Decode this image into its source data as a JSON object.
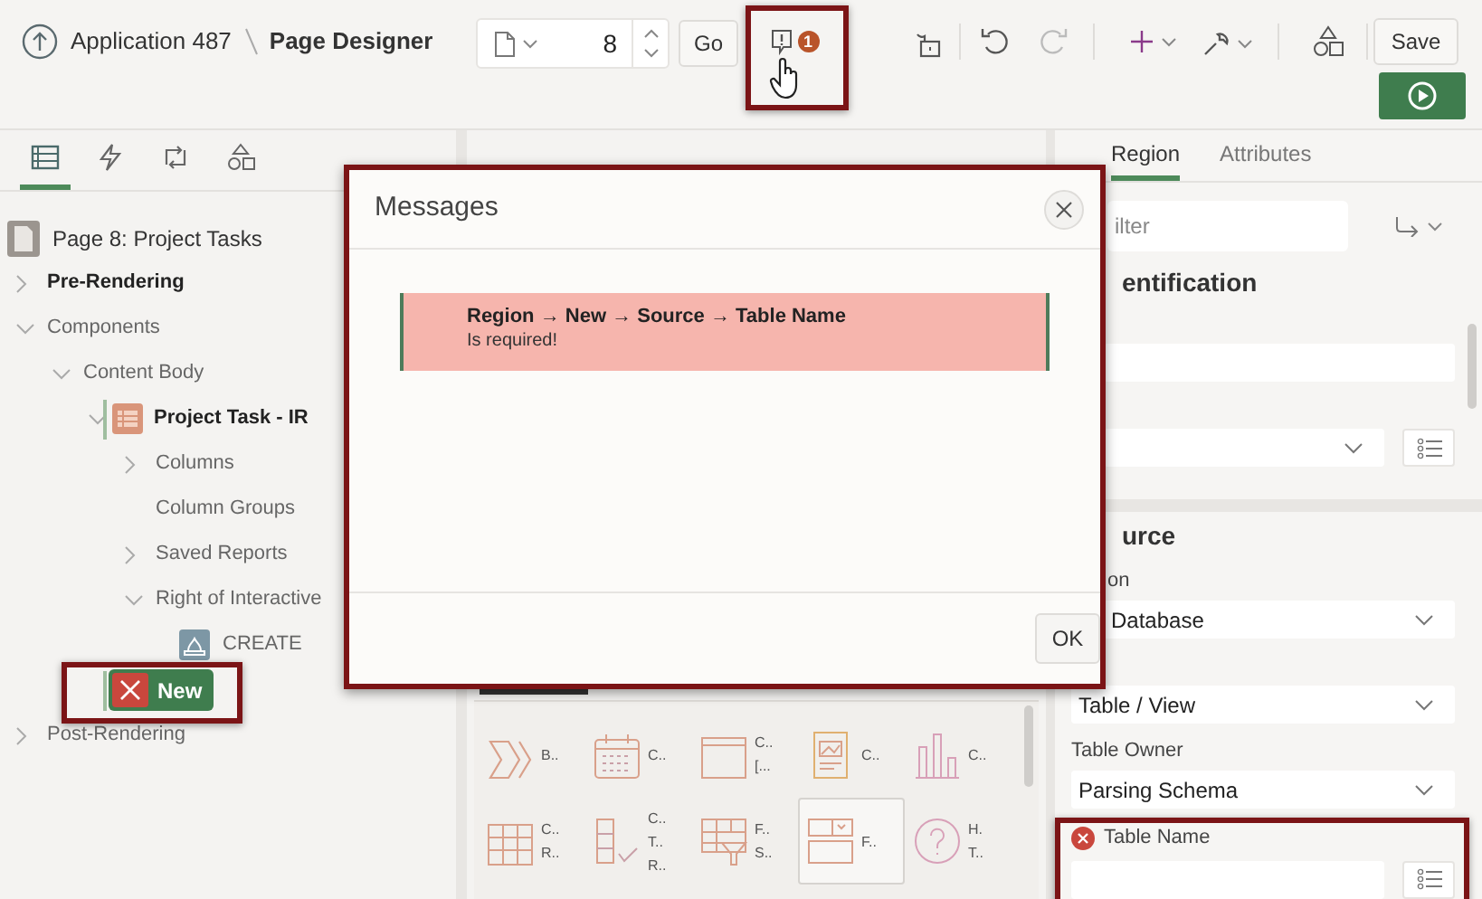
{
  "header": {
    "app": "Application 487",
    "title": "Page Designer",
    "page_number": "8",
    "go": "Go",
    "message_count": "1",
    "save": "Save"
  },
  "left_tabs": [
    {
      "kind": "rendering",
      "selected": true
    },
    {
      "kind": "dynamic",
      "selected": false
    },
    {
      "kind": "processing",
      "selected": false
    },
    {
      "kind": "shared",
      "selected": false
    }
  ],
  "tree": {
    "label": "Page 8: Project Tasks",
    "children": [
      {
        "label": "Pre-Rendering",
        "kind": "folder",
        "expanded": false,
        "emphasized": true
      },
      {
        "label": "Components",
        "kind": "folder",
        "expanded": true,
        "emphasized": false,
        "children": [
          {
            "label": "Content Body",
            "kind": "folder",
            "expanded": true,
            "emphasized": false,
            "children": [
              {
                "label": "Project Task - IR",
                "kind": "region",
                "expanded": true,
                "emphasized": true,
                "children": [
                  {
                    "label": "Columns",
                    "kind": "folder",
                    "expanded": false,
                    "emphasized": false
                  },
                  {
                    "label": "Column Groups",
                    "kind": "leaf",
                    "emphasized": false
                  },
                  {
                    "label": "Saved Reports",
                    "kind": "folder",
                    "expanded": false,
                    "emphasized": false
                  },
                  {
                    "label": "Right of Interactive",
                    "kind": "folder",
                    "expanded": true,
                    "emphasized": false,
                    "children": [
                      {
                        "label": "CREATE",
                        "kind": "button",
                        "emphasized": false
                      }
                    ]
                  }
                ]
              },
              {
                "label": "New",
                "kind": "error-region",
                "emphasized": true
              }
            ]
          }
        ]
      },
      {
        "label": "Post-Rendering",
        "kind": "folder",
        "expanded": false,
        "emphasized": false
      }
    ]
  },
  "gallery": [
    {
      "kind": "breadcrumb",
      "lines": [
        "B.."
      ],
      "selected": false
    },
    {
      "kind": "calendar",
      "lines": [
        "C.."
      ],
      "selected": false
    },
    {
      "kind": "card",
      "lines": [
        "C..",
        "[..."
      ],
      "selected": false
    },
    {
      "kind": "report",
      "lines": [
        "C.."
      ],
      "selected": false
    },
    {
      "kind": "chart",
      "lines": [
        "C.."
      ],
      "selected": false
    },
    {
      "kind": "grid",
      "lines": [
        "C..",
        "R.."
      ],
      "selected": false
    },
    {
      "kind": "checklist",
      "lines": [
        "C..",
        "T..",
        "R.."
      ],
      "selected": false
    },
    {
      "kind": "filter",
      "lines": [
        "F..",
        "S.."
      ],
      "selected": false
    },
    {
      "kind": "form",
      "lines": [
        "F.."
      ],
      "selected": true
    },
    {
      "kind": "help",
      "lines": [
        "H.",
        "T.."
      ],
      "selected": false
    }
  ],
  "modal": {
    "title": "Messages",
    "messages": [
      {
        "path": "Region → New → Source → Table Name",
        "text": "Is required!"
      }
    ],
    "ok": "OK"
  },
  "right": {
    "tabs": [
      {
        "label": "Region",
        "selected": true
      },
      {
        "label": "Attributes",
        "selected": false
      }
    ],
    "filter_placeholder": "ilter",
    "groups": [
      {
        "heading": "entification",
        "rows": [
          {
            "kind": "text-field"
          },
          {
            "kind": "select-lov"
          }
        ]
      },
      {
        "heading": "urce",
        "rows": [
          {
            "kind": "label",
            "text": "on"
          },
          {
            "kind": "select",
            "value": "Database"
          },
          {
            "kind": "select",
            "value": "Table / View"
          },
          {
            "kind": "label",
            "text": "Table Owner"
          },
          {
            "kind": "select",
            "value": "Parsing Schema"
          },
          {
            "kind": "error-label",
            "text": "Table Name"
          },
          {
            "kind": "text-field-lov"
          }
        ]
      }
    ]
  }
}
